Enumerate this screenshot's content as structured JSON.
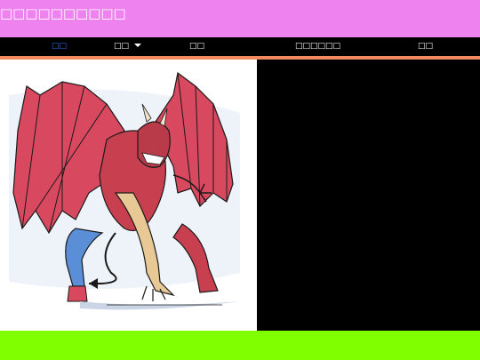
{
  "header": {
    "site_title": "□□□□□□□□□□",
    "background": "#ee82ee"
  },
  "nav": {
    "background": "#000000",
    "accent_color": "#f08a5d",
    "active_color": "#2f6fe0",
    "items": [
      {
        "label": "□□",
        "active": true
      },
      {
        "label": "□□",
        "has_dropdown": true,
        "icon": "chevron-down-icon"
      },
      {
        "label": "□□"
      },
      {
        "label": "□□□□□□"
      },
      {
        "label": "□□"
      }
    ]
  },
  "main": {
    "artwork": {
      "subject": "red winged demon creature drawing",
      "colors": {
        "wings": "#d8485f",
        "body": "#c8404f",
        "legs": "#e8c995",
        "jeans": "#5a8ed6",
        "outline": "#1a1a1a"
      }
    },
    "side_panel_color": "#000000"
  },
  "footer": {
    "background": "#7fff00"
  }
}
